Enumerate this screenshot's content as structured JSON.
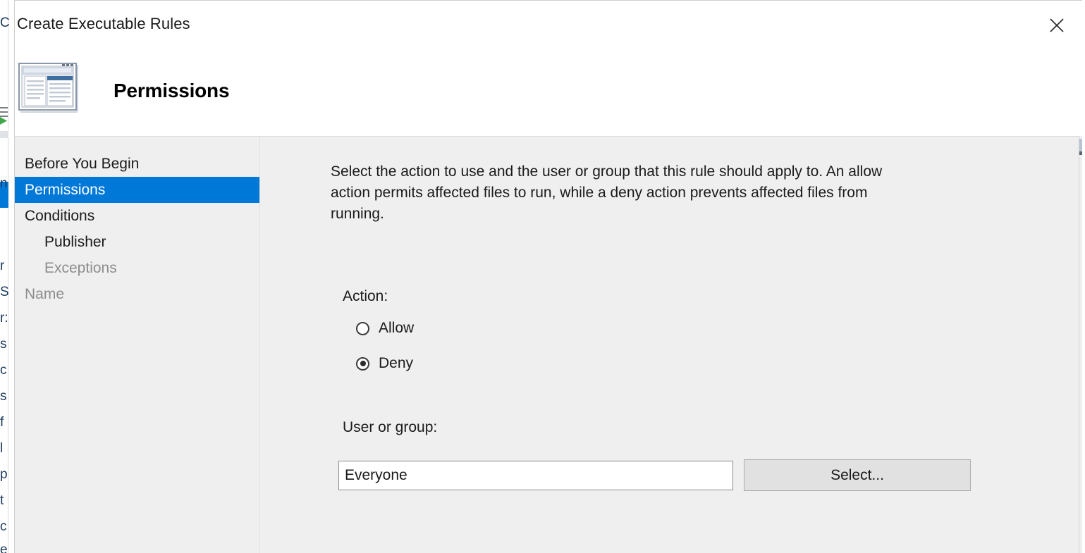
{
  "window": {
    "title": "Create Executable Rules",
    "close_label": "✕",
    "page_heading": "Permissions",
    "icon": "wizard-window-icon"
  },
  "sidebar": {
    "items": [
      {
        "label": "Before You Begin",
        "state": "normal",
        "indent": false
      },
      {
        "label": "Permissions",
        "state": "selected",
        "indent": false
      },
      {
        "label": "Conditions",
        "state": "normal",
        "indent": false
      },
      {
        "label": "Publisher",
        "state": "normal",
        "indent": true
      },
      {
        "label": "Exceptions",
        "state": "disabled",
        "indent": true
      },
      {
        "label": "Name",
        "state": "disabled",
        "indent": false
      }
    ]
  },
  "content": {
    "description": "Select the action to use and the user or group that this rule should apply to. An allow action permits affected files to run, while a deny action prevents affected files from running.",
    "action_label": "Action:",
    "radios": [
      {
        "label": "Allow",
        "checked": false
      },
      {
        "label": "Deny",
        "checked": true
      }
    ],
    "user_or_group_label": "User or group:",
    "user_or_group_value": "Everyone",
    "user_or_group_placeholder": "",
    "select_button_label": "Select..."
  },
  "colors": {
    "accent": "#0078D7",
    "dialog_bg": "#EFEFEF",
    "header_bg": "#FFFFFF",
    "button_bg": "#E1E1E1",
    "text": "#1A1A1A",
    "disabled_text": "#8D8D8D"
  }
}
